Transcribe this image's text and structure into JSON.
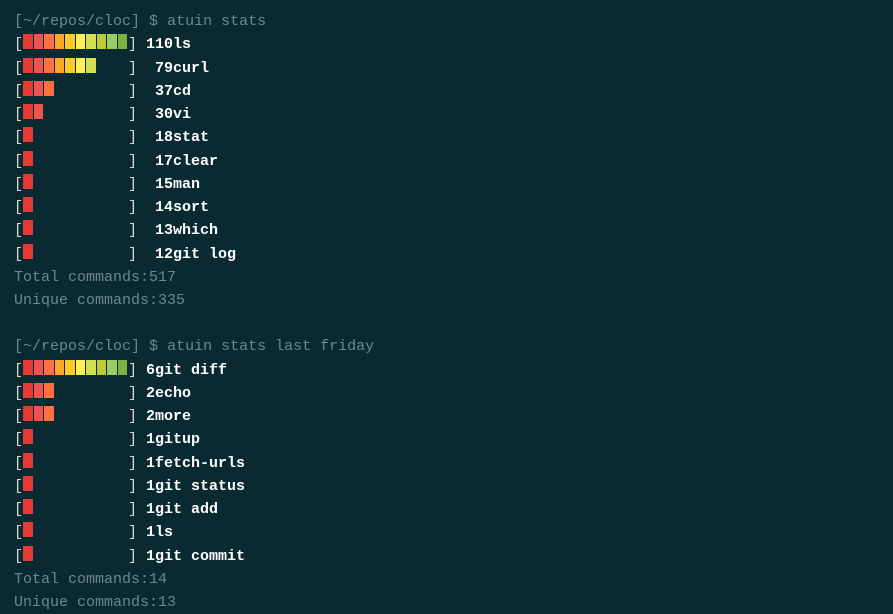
{
  "colors": {
    "gradient": [
      "#e53935",
      "#ef5350",
      "#ff7043",
      "#ffa726",
      "#ffca28",
      "#ffee58",
      "#d4e157",
      "#c0ca33",
      "#9ccc65",
      "#7cb342"
    ]
  },
  "blocks": [
    {
      "prompt": {
        "path": "[~/repos/cloc]",
        "symbol": "$",
        "command": "atuin stats"
      },
      "max": 110,
      "count_width": 3,
      "rows": [
        {
          "bars": 10,
          "count": 110,
          "cmd": "ls"
        },
        {
          "bars": 7,
          "count": 79,
          "cmd": "curl"
        },
        {
          "bars": 3,
          "count": 37,
          "cmd": "cd"
        },
        {
          "bars": 2,
          "count": 30,
          "cmd": "vi"
        },
        {
          "bars": 1,
          "count": 18,
          "cmd": "stat"
        },
        {
          "bars": 1,
          "count": 17,
          "cmd": "clear"
        },
        {
          "bars": 1,
          "count": 15,
          "cmd": "man"
        },
        {
          "bars": 1,
          "count": 14,
          "cmd": "sort"
        },
        {
          "bars": 1,
          "count": 13,
          "cmd": "which"
        },
        {
          "bars": 1,
          "count": 12,
          "cmd": "git log"
        }
      ],
      "summary": {
        "total_label": "Total commands:",
        "total": 517,
        "unique_label": "Unique commands:",
        "unique": 335
      }
    },
    {
      "prompt": {
        "path": "[~/repos/cloc]",
        "symbol": "$",
        "command": "atuin stats last friday"
      },
      "max": 6,
      "count_width": 1,
      "rows": [
        {
          "bars": 10,
          "count": 6,
          "cmd": "git diff"
        },
        {
          "bars": 3,
          "count": 2,
          "cmd": "echo"
        },
        {
          "bars": 3,
          "count": 2,
          "cmd": "more"
        },
        {
          "bars": 1,
          "count": 1,
          "cmd": "gitup"
        },
        {
          "bars": 1,
          "count": 1,
          "cmd": "fetch-urls"
        },
        {
          "bars": 1,
          "count": 1,
          "cmd": "git status"
        },
        {
          "bars": 1,
          "count": 1,
          "cmd": "git add"
        },
        {
          "bars": 1,
          "count": 1,
          "cmd": "ls"
        },
        {
          "bars": 1,
          "count": 1,
          "cmd": "git commit"
        }
      ],
      "summary": {
        "total_label": "Total commands:",
        "total": 14,
        "unique_label": "Unique commands:",
        "unique": 13
      }
    }
  ]
}
